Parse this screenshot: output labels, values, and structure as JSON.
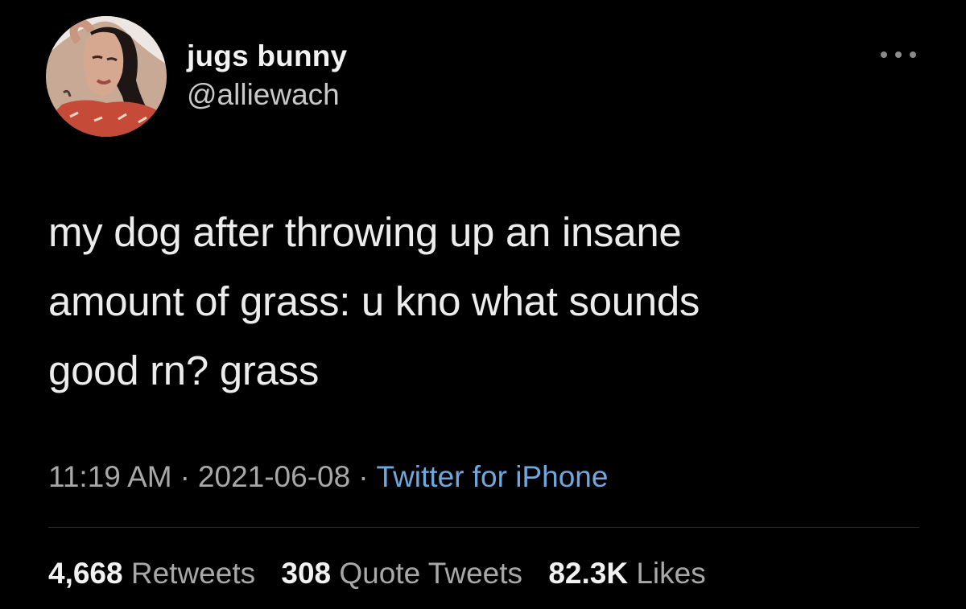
{
  "author": {
    "display_name": "jugs bunny",
    "handle": "@alliewach",
    "avatar_icon": "profile-photo"
  },
  "menu_icon": "more-dots-icon",
  "tweet": {
    "lines": [
      "my dog after throwing up an insane",
      "amount of grass: u kno what sounds",
      "good rn? grass"
    ]
  },
  "meta": {
    "time": "11:19 AM",
    "separator": "·",
    "date": "2021-06-08",
    "source": "Twitter for iPhone"
  },
  "stats": {
    "retweets": {
      "count": "4,668",
      "label": "Retweets"
    },
    "quotes": {
      "count": "308",
      "label": "Quote Tweets"
    },
    "likes": {
      "count": "82.3K",
      "label": "Likes"
    }
  },
  "colors": {
    "background": "#000000",
    "link": "#6fa8dc",
    "secondary": "#a8a8a8"
  }
}
